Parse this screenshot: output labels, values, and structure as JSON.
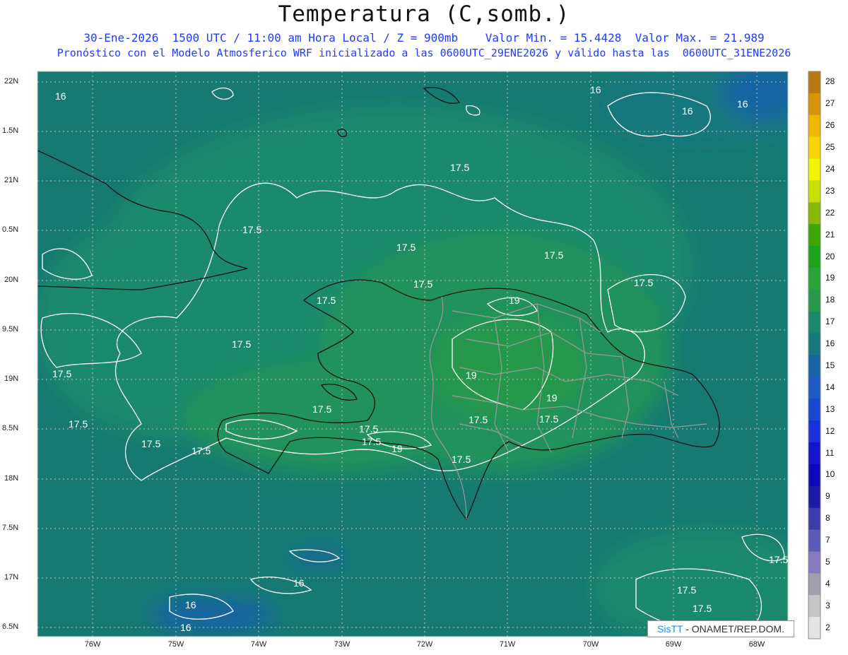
{
  "title": "Temperatura (C,somb.)",
  "subtitle_line1": "30-Ene-2026  1500 UTC / 11:00 am Hora Local / Z = 900mb    Valor Min. = 15.4428  Valor Max. = 21.989",
  "subtitle_line2": "Pronóstico con el Modelo Atmosferico WRF inicializado a las 0600UTC_29ENE2026 y válido hasta las  0600UTC_31ENE2026",
  "lat_labels": [
    "22N",
    "1.5N",
    "21N",
    "0.5N",
    "20N",
    "9.5N",
    "19N",
    "8.5N",
    "18N",
    "7.5N",
    "17N",
    "6.5N"
  ],
  "lon_labels": [
    "76W",
    "75W",
    "74W",
    "73W",
    "72W",
    "71W",
    "70W",
    "69W",
    "68W"
  ],
  "colorbar": {
    "levels": [
      "28",
      "27",
      "26",
      "25",
      "24",
      "23",
      "22",
      "21",
      "20",
      "19",
      "18",
      "17",
      "16",
      "15",
      "14",
      "13",
      "12",
      "11",
      "10",
      "9",
      "8",
      "7",
      "5",
      "4",
      "3",
      "2"
    ],
    "colors": [
      "#b8790e",
      "#d8930a",
      "#f2b600",
      "#f8d400",
      "#f2f400",
      "#c8e000",
      "#88b800",
      "#3aa800",
      "#1ca51c",
      "#29a438",
      "#279a4c",
      "#1a8a6c",
      "#14787e",
      "#1464a6",
      "#1e5ac8",
      "#1c46d6",
      "#1a30d8",
      "#1414d0",
      "#0a0ab8",
      "#1a1aa8",
      "#3c3cae",
      "#5c5cb6",
      "#8878c0",
      "#a0a0ac",
      "#c6c6c6",
      "#e4e4e4"
    ]
  },
  "contour_labels": [
    "16",
    "16",
    "16",
    "16",
    "16",
    "16",
    "16",
    "17.5",
    "17.5",
    "17.5",
    "17.5",
    "17.5",
    "17.5",
    "17.5",
    "17.5",
    "17.5",
    "17.5",
    "17.5",
    "17.5",
    "17.5",
    "17.5",
    "17.5",
    "17.5",
    "17.5",
    "17.5",
    "17.5",
    "17.5",
    "19",
    "19",
    "19",
    "19",
    "17.5"
  ],
  "credit": {
    "part1": "SisTT",
    "part2": "- ONAMET/REP.DOM."
  }
}
